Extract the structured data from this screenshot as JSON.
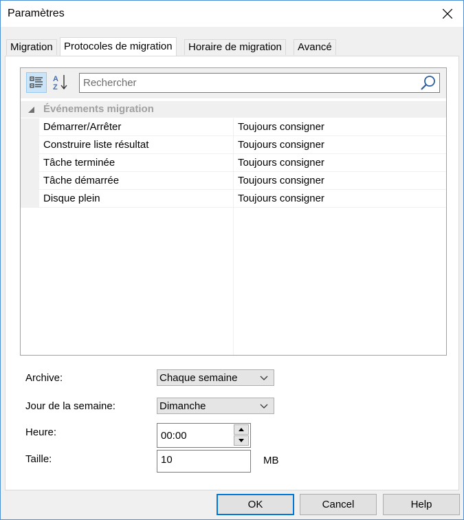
{
  "window": {
    "title": "Paramètres"
  },
  "tabs": [
    {
      "label": "Migration"
    },
    {
      "label": "Protocoles de migration",
      "active": true
    },
    {
      "label": "Horaire de migration"
    },
    {
      "label": "Avancé"
    }
  ],
  "property_grid": {
    "toolbar": {
      "categorized_icon": "categorized-view-icon",
      "alphabetical_icon": "sort-alphabetical-icon",
      "search_placeholder": "Rechercher",
      "search_value": ""
    },
    "category": {
      "label": "Événements migration",
      "expanded": true
    },
    "rows": [
      {
        "name": "Démarrer/Arrêter",
        "value": "Toujours consigner"
      },
      {
        "name": "Construire liste résultat",
        "value": "Toujours consigner"
      },
      {
        "name": "Tâche terminée",
        "value": "Toujours consigner"
      },
      {
        "name": "Tâche démarrée",
        "value": "Toujours consigner"
      },
      {
        "name": "Disque plein",
        "value": "Toujours consigner"
      }
    ]
  },
  "form": {
    "archive": {
      "label": "Archive:",
      "value": "Chaque semaine"
    },
    "weekday": {
      "label": "Jour de la semaine:",
      "value": "Dimanche"
    },
    "time": {
      "label": "Heure:",
      "value": "00:00"
    },
    "size": {
      "label": "Taille:",
      "value": "10",
      "unit": "MB"
    }
  },
  "buttons": {
    "ok": "OK",
    "cancel": "Cancel",
    "help": "Help"
  },
  "colors": {
    "accent": "#0078d7",
    "window_border": "#4d90d6",
    "dialog_bg": "#f0f0f0"
  }
}
